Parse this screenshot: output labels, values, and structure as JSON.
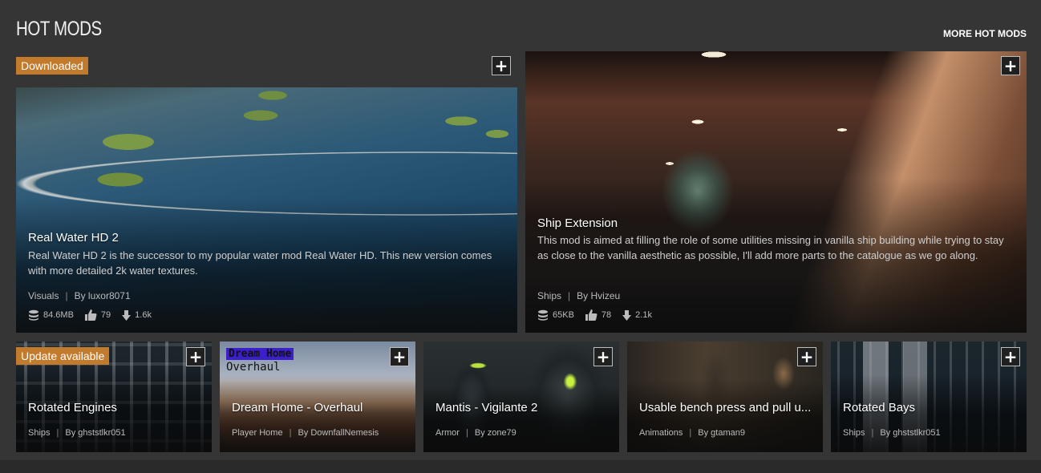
{
  "section": {
    "title": "HOT MODS",
    "more_link": "MORE HOT MODS"
  },
  "featured": [
    {
      "badge": "Downloaded",
      "title": "Real Water HD 2",
      "description": "Real Water HD 2 is the successor to my popular water mod Real Water HD. This new version comes with more detailed 2k water textures.",
      "category": "Visuals",
      "author": "By luxor8071",
      "size": "84.6MB",
      "endorsements": "79",
      "downloads": "1.6k"
    },
    {
      "badge": "",
      "title": "Ship Extension",
      "description": "This mod is aimed at filling the role of some utilities missing in vanilla ship building while trying to stay as close to the vanilla aesthetic as possible, I'll add more parts to the catalogue as we go along.",
      "category": "Ships",
      "author": "By Hvizeu",
      "size": "65KB",
      "endorsements": "78",
      "downloads": "2.1k"
    }
  ],
  "small": [
    {
      "badge": "Update available",
      "title": "Rotated Engines",
      "category": "Ships",
      "author": "By ghststlkr051"
    },
    {
      "badge": "",
      "title": "Dream Home - Overhaul",
      "category": "Player Home",
      "author": "By DownfallNemesis",
      "art_line1": "Dream Home",
      "art_line2": "Overhaul"
    },
    {
      "badge": "",
      "title": "Mantis - Vigilante 2",
      "category": "Armor",
      "author": "By zone79"
    },
    {
      "badge": "",
      "title": "Usable bench press and pull u...",
      "category": "Animations",
      "author": "By gtaman9"
    },
    {
      "badge": "",
      "title": "Rotated Bays",
      "category": "Ships",
      "author": "By ghststlkr051"
    }
  ],
  "colors": {
    "background": "#353535",
    "badge": "#c27a2c"
  },
  "icons": {
    "add": "plus-icon",
    "size": "database-icon",
    "endorse": "thumbs-up-icon",
    "download": "download-arrow-icon"
  },
  "plus_glyph": "+"
}
